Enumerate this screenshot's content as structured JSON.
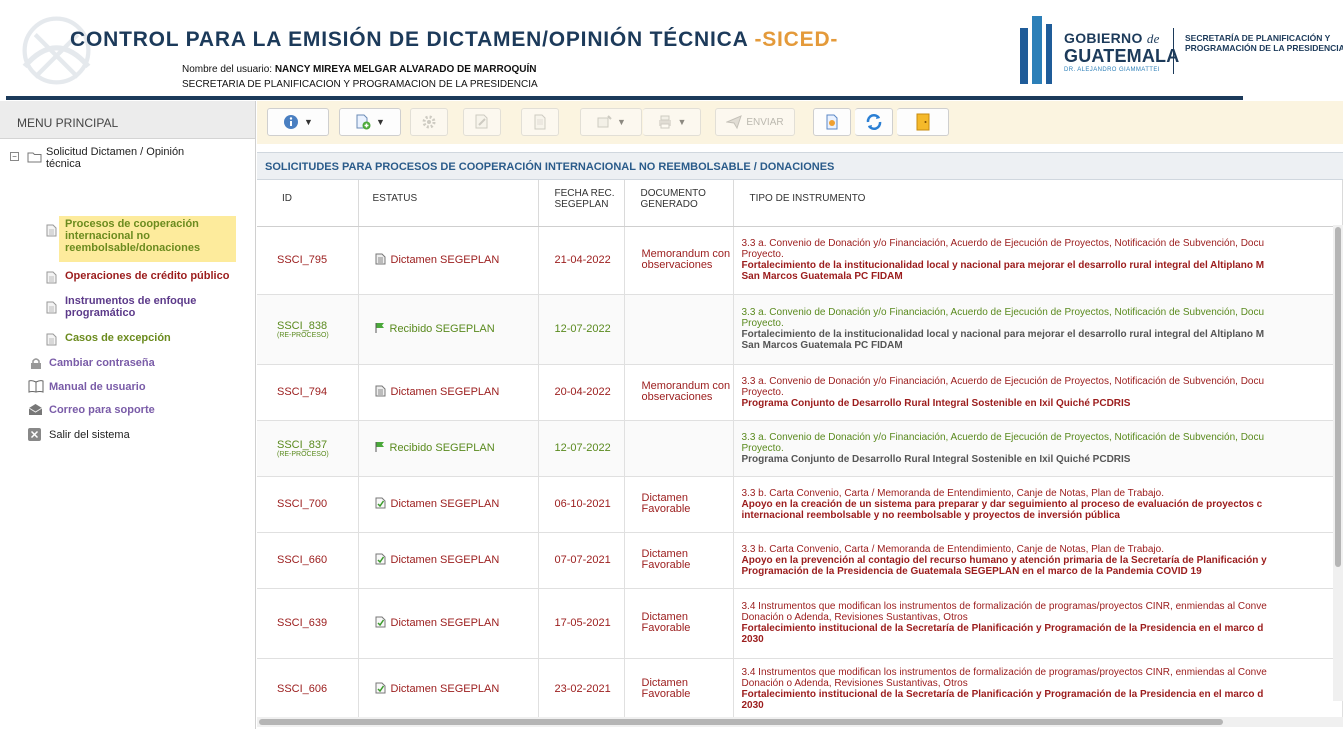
{
  "header": {
    "title_main": "CONTROL PARA LA EMISIÓN DE DICTAMEN/OPINIÓN TÉCNICA ",
    "title_accent": "-SICED-",
    "user_label": "Nombre del usuario: ",
    "user_name": "NANCY MIREYA MELGAR ALVARADO DE MARROQUÍN",
    "organization": "SECRETARIA DE PLANIFICACION Y PROGRAMACION DE LA PRESIDENCIA",
    "gov_logo": {
      "line1_word": "GOBIERNO",
      "line1_de": "de",
      "line2": "GUATEMALA",
      "line3": "DR. ALEJANDRO GIAMMATTEI"
    },
    "secretariat": "SECRETARÍA DE PLANIFICACIÓN Y PROGRAMACIÓN DE LA PRESIDENCIA"
  },
  "sidebar": {
    "menu_title": "MENU PRINCIPAL",
    "root_label": "Solicitud Dictamen / Opinión técnica",
    "items": [
      {
        "label": "Procesos de cooperación internacional no reembolsable/donaciones",
        "icon": "document-icon",
        "color": "#6b8b1e",
        "selected": true
      },
      {
        "label": "Operaciones de crédito público",
        "icon": "document-icon",
        "color": "#9b1c1c"
      },
      {
        "label": "Instrumentos de enfoque programático",
        "icon": "document-icon",
        "color": "#5c3a8a"
      },
      {
        "label": "Casos de excepción",
        "icon": "document-icon",
        "color": "#6b8b1e"
      }
    ],
    "links": [
      {
        "label": "Cambiar contraseña",
        "icon": "lock-icon"
      },
      {
        "label": "Manual de usuario",
        "icon": "book-icon"
      },
      {
        "label": "Correo para soporte",
        "icon": "mail-icon"
      },
      {
        "label": "Salir del sistema",
        "icon": "exit-icon"
      }
    ]
  },
  "toolbar": {
    "enviar_label": "ENVIAR"
  },
  "section_title": "SOLICITUDES PARA PROCESOS DE COOPERACIÓN INTERNACIONAL NO REEMBOLSABLE / DONACIONES",
  "table": {
    "columns": {
      "id": "ID",
      "status": "ESTATUS",
      "date_l1": "FECHA REC.",
      "date_l2": "SEGEPLAN",
      "doc_l1": "DOCUMENTO",
      "doc_l2": "GENERADO",
      "type": "TIPO DE INSTRUMENTO"
    },
    "rows": [
      {
        "id": "SSCI_795",
        "reproc": "",
        "status": "Dictamen SEGEPLAN",
        "status_icon": "document-icon",
        "date": "21-04-2022",
        "doc": "Memorandum con observaciones",
        "inst_l1": "3.3 a. Convenio de Donación y/o Financiación, Acuerdo de Ejecución de Proyectos, Notificación de Subvención, Docu",
        "inst_l2": "Proyecto.",
        "inst_l3": "Fortalecimiento de la institucionalidad local y nacional para mejorar el desarrollo rural integral del Altiplano M",
        "inst_l4": "San Marcos Guatemala PC FIDAM"
      },
      {
        "id": "SSCI_838",
        "reproc": "(RE-PROCESO)",
        "status": "Recibido SEGEPLAN",
        "status_icon": "flag-icon",
        "date": "12-07-2022",
        "doc": "",
        "inst_l1": "3.3 a. Convenio de Donación y/o Financiación, Acuerdo de Ejecución de Proyectos, Notificación de Subvención, Docu",
        "inst_l2": "Proyecto.",
        "inst_l3": "Fortalecimiento de la institucionalidad local y nacional para mejorar el desarrollo rural integral del Altiplano M",
        "inst_l4": "San Marcos Guatemala PC FIDAM"
      },
      {
        "id": "SSCI_794",
        "reproc": "",
        "status": "Dictamen SEGEPLAN",
        "status_icon": "document-icon",
        "date": "20-04-2022",
        "doc": "Memorandum con observaciones",
        "inst_l1": "3.3 a. Convenio de Donación y/o Financiación, Acuerdo de Ejecución de Proyectos, Notificación de Subvención, Docu",
        "inst_l2": "Proyecto.",
        "inst_l3": "Programa Conjunto de Desarrollo Rural Integral Sostenible en Ixil Quiché PCDRIS",
        "inst_l4": ""
      },
      {
        "id": "SSCI_837",
        "reproc": "(RE-PROCESO)",
        "status": "Recibido SEGEPLAN",
        "status_icon": "flag-icon",
        "date": "12-07-2022",
        "doc": "",
        "inst_l1": "3.3 a. Convenio de Donación y/o Financiación, Acuerdo de Ejecución de Proyectos, Notificación de Subvención, Docu",
        "inst_l2": "Proyecto.",
        "inst_l3": "Programa Conjunto de Desarrollo Rural Integral Sostenible en Ixil Quiché PCDRIS",
        "inst_l4": ""
      },
      {
        "id": "SSCI_700",
        "reproc": "",
        "status": "Dictamen SEGEPLAN",
        "status_icon": "checked-document-icon",
        "date": "06-10-2021",
        "doc": "Dictamen Favorable",
        "inst_l1": "3.3 b. Carta Convenio, Carta / Memoranda de Entendimiento, Canje de Notas, Plan de Trabajo.",
        "inst_l2": "",
        "inst_l3": "Apoyo en la creación de un sistema para preparar y dar seguimiento al proceso de evaluación de proyectos c",
        "inst_l4": "internacional reembolsable y no reembolsable y proyectos de inversión pública"
      },
      {
        "id": "SSCI_660",
        "reproc": "",
        "status": "Dictamen SEGEPLAN",
        "status_icon": "checked-document-icon",
        "date": "07-07-2021",
        "doc": "Dictamen Favorable",
        "inst_l1": "3.3 b. Carta Convenio, Carta / Memoranda de Entendimiento, Canje de Notas, Plan de Trabajo.",
        "inst_l2": "",
        "inst_l3": "Apoyo en la prevención al contagio del recurso humano y atención primaria de la Secretaría de Planificación y",
        "inst_l4": "Programación de la Presidencia de Guatemala SEGEPLAN en el marco de la Pandemia COVID 19"
      },
      {
        "id": "SSCI_639",
        "reproc": "",
        "status": "Dictamen SEGEPLAN",
        "status_icon": "checked-document-icon",
        "date": "17-05-2021",
        "doc": "Dictamen Favorable",
        "inst_l1": "3.4 Instrumentos que modifican los instrumentos de formalización de programas/proyectos CINR, enmiendas al Conve",
        "inst_l2": "Donación o Adenda, Revisiones Sustantivas, Otros",
        "inst_l3": "Fortalecimiento institucional de la Secretaría de Planificación y Programación de la Presidencia en el marco d",
        "inst_l4": "2030"
      },
      {
        "id": "SSCI_606",
        "reproc": "",
        "status": "Dictamen SEGEPLAN",
        "status_icon": "checked-document-icon",
        "date": "23-02-2021",
        "doc": "Dictamen Favorable",
        "inst_l1": "3.4 Instrumentos que modifican los instrumentos de formalización de programas/proyectos CINR, enmiendas al Conve",
        "inst_l2": "Donación o Adenda, Revisiones Sustantivas, Otros",
        "inst_l3": "Fortalecimiento institucional de la Secretaría de Planificación y Programación de la Presidencia en el marco d",
        "inst_l4": "2030"
      }
    ]
  },
  "colors": {
    "navy": "#1c3a5a",
    "accent": "#e49a3a",
    "red": "#9b1c1c",
    "green": "#5a8a1e",
    "purple": "#7a5ca8",
    "highlight": "#fdeb9c"
  }
}
